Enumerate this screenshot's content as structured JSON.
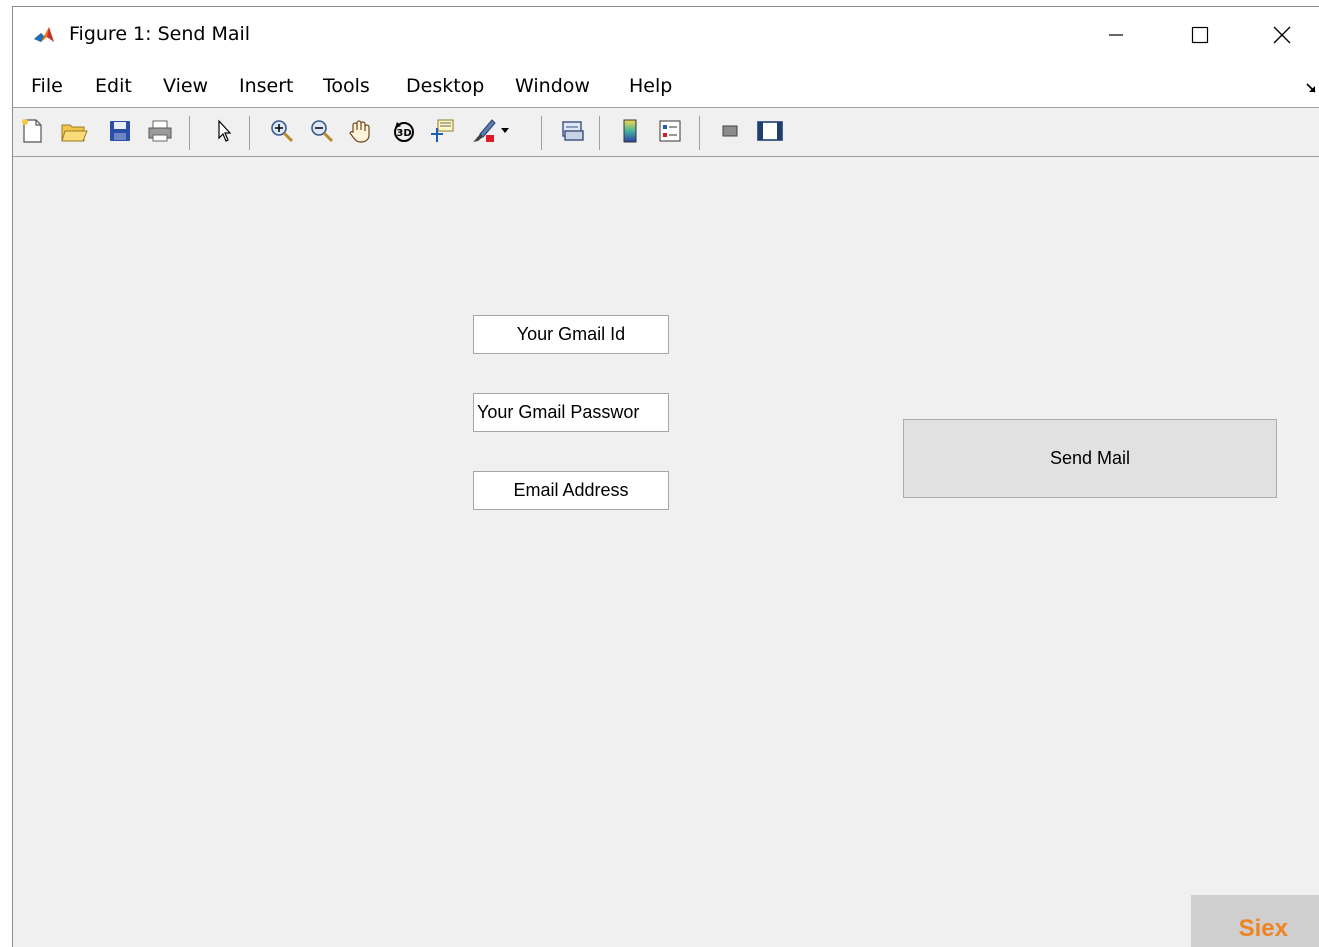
{
  "window": {
    "title": "Figure 1: Send Mail",
    "controls": {
      "minimize": "—",
      "maximize": "☐",
      "close": "✕"
    }
  },
  "menubar": {
    "items": [
      "File",
      "Edit",
      "View",
      "Insert",
      "Tools",
      "Desktop",
      "Window",
      "Help"
    ]
  },
  "toolbar": {
    "icons": [
      "new-figure-icon",
      "open-file-icon",
      "save-icon",
      "print-icon",
      "pointer-icon",
      "zoom-in-icon",
      "zoom-out-icon",
      "pan-icon",
      "rotate-3d-icon",
      "data-cursor-icon",
      "brush-icon",
      "link-plot-icon",
      "colorbar-icon",
      "legend-icon",
      "hide-plot-tools-icon",
      "show-plot-tools-icon"
    ]
  },
  "form": {
    "gmail_id": "Your Gmail Id",
    "gmail_password": "Your Gmail Passwor",
    "email_address": "Email Address",
    "send_button": "Send Mail"
  },
  "watermark": "Siex",
  "colors": {
    "canvas": "#f0f0f0",
    "button": "#e1e1e1",
    "watermark": "#ee8422"
  }
}
